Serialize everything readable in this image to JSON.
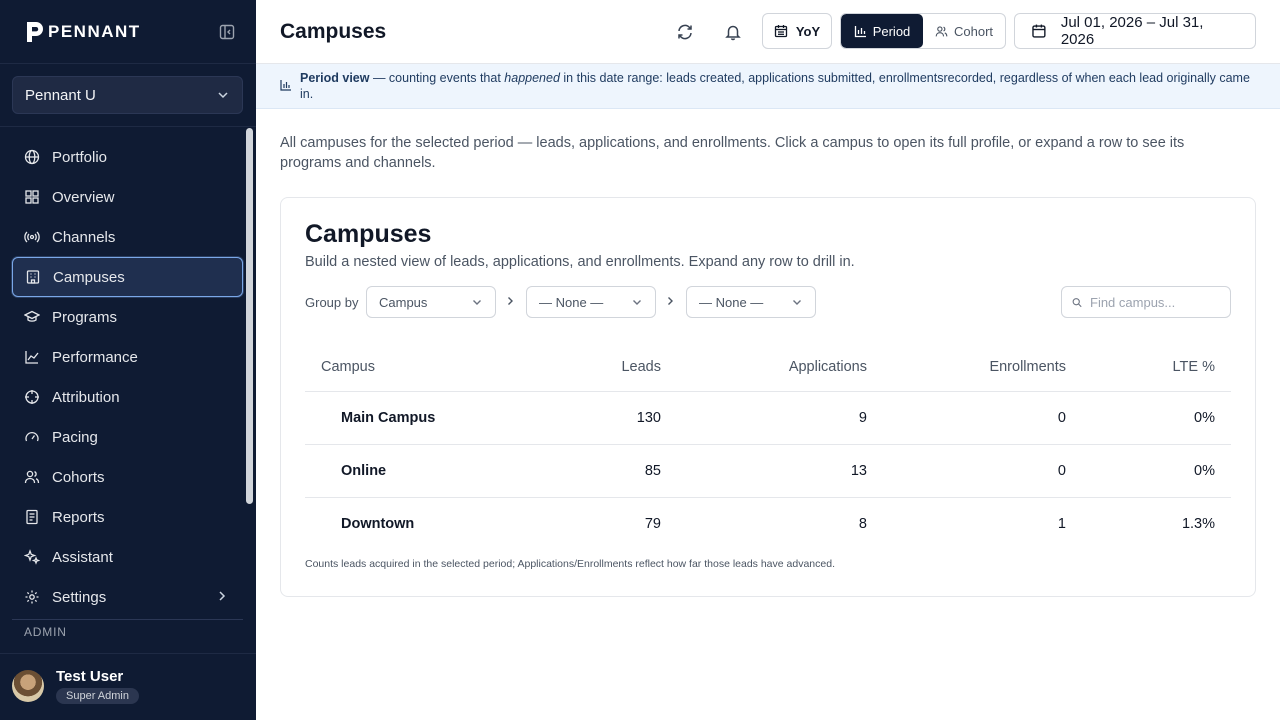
{
  "brand": {
    "name": "PENNANT"
  },
  "tenant": {
    "name": "Pennant U"
  },
  "nav": {
    "items": [
      {
        "label": "Portfolio",
        "icon": "globe-icon"
      },
      {
        "label": "Overview",
        "icon": "grid-icon"
      },
      {
        "label": "Channels",
        "icon": "broadcast-icon"
      },
      {
        "label": "Campuses",
        "icon": "building-icon",
        "active": true
      },
      {
        "label": "Programs",
        "icon": "graduation-cap-icon"
      },
      {
        "label": "Performance",
        "icon": "line-chart-icon"
      },
      {
        "label": "Attribution",
        "icon": "crosshair-icon"
      },
      {
        "label": "Pacing",
        "icon": "gauge-icon"
      },
      {
        "label": "Cohorts",
        "icon": "users-icon"
      },
      {
        "label": "Reports",
        "icon": "report-icon"
      },
      {
        "label": "Assistant",
        "icon": "sparkles-icon"
      },
      {
        "label": "Settings",
        "icon": "gear-icon"
      }
    ],
    "admin_label": "ADMIN"
  },
  "user": {
    "name": "Test User",
    "role": "Super Admin"
  },
  "header": {
    "title": "Campuses",
    "yoy_label": "YoY",
    "period_label": "Period",
    "cohort_label": "Cohort",
    "date_range": "Jul 01, 2026 – Jul 31, 2026"
  },
  "banner": {
    "title": "Period view",
    "text_before": " — counting events that ",
    "emphasis": "happened",
    "text_after": " in this date range: leads created, applications submitted, enrollmentsrecorded, regardless of when each lead originally came in."
  },
  "intro": "All campuses for the selected period — leads, applications, and enrollments. Click a campus to open its full profile, or expand a row to see its programs and channels.",
  "card": {
    "title": "Campuses",
    "subtitle": "Build a nested view of leads, applications, and enrollments. Expand any row to drill in.",
    "group_by_label": "Group by",
    "group_1": "Campus",
    "group_2": "— None —",
    "group_3": "— None —",
    "search_placeholder": "Find campus...",
    "columns": [
      "Campus",
      "Leads",
      "Applications",
      "Enrollments",
      "LTE %"
    ],
    "rows": [
      {
        "campus": "Main Campus",
        "leads": "130",
        "applications": "9",
        "enrollments": "0",
        "lte": "0%"
      },
      {
        "campus": "Online",
        "leads": "85",
        "applications": "13",
        "enrollments": "0",
        "lte": "0%"
      },
      {
        "campus": "Downtown",
        "leads": "79",
        "applications": "8",
        "enrollments": "1",
        "lte": "1.3%"
      }
    ],
    "footnote": "Counts leads acquired in the selected period; Applications/Enrollments reflect how far those leads have advanced."
  },
  "colors": {
    "sidebar_bg": "#0f1b33",
    "accent_active": "#7aa7e8",
    "banner_bg": "#eef5fd"
  }
}
